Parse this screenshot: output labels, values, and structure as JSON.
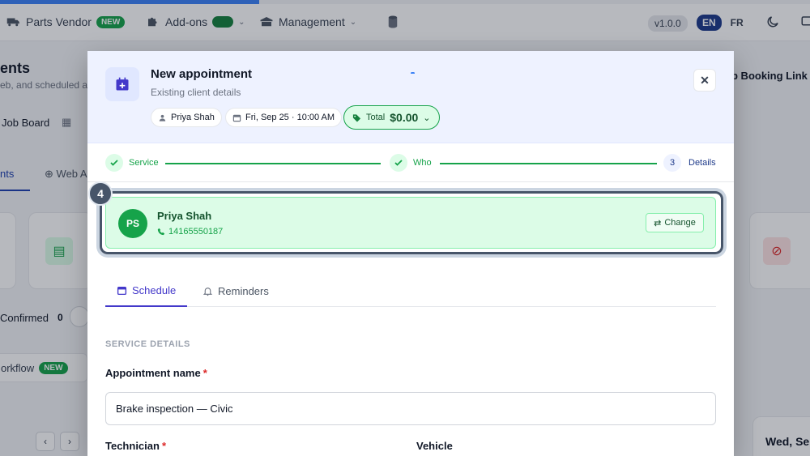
{
  "progress": {
    "fraction": 0.32
  },
  "topnav": {
    "parts_vendor": "Parts Vendor",
    "parts_vendor_badge": "NEW",
    "addons": "Add-ons",
    "management": "Management",
    "version": "v1.0.0",
    "lang_en": "EN",
    "lang_fr": "FR"
  },
  "background": {
    "page_title_fragment": "ents",
    "subtitle_fragment": "eb, and scheduled ap",
    "job_board": "Job Board",
    "booking_link": "p Booking Link",
    "tab_fragment_active": "nts",
    "tab_fragment_web": "Web A",
    "confirmed_label": "Confirmed",
    "confirmed_count": "0",
    "workflow_label": "orkflow",
    "workflow_badge": "NEW",
    "date_fragment": "Wed, Se"
  },
  "modal": {
    "title": "New appointment",
    "subtitle": "Existing client details",
    "chip_client": "Priya Shah",
    "chip_datetime": "Fri, Sep 25 · 10:00 AM",
    "chip_total_label": "Total",
    "chip_total_value": "$0.00",
    "close_symbol": "✕",
    "steps": [
      {
        "label": "Service",
        "state": "done"
      },
      {
        "label": "Who",
        "state": "done"
      },
      {
        "label": "Details",
        "number": "3",
        "state": "current"
      }
    ],
    "step_marker": "4",
    "client": {
      "initials": "PS",
      "name": "Priya Shah",
      "phone": "14165550187",
      "change_label": "Change"
    },
    "tabs": [
      {
        "label": "Schedule",
        "active": true
      },
      {
        "label": "Reminders",
        "active": false
      }
    ],
    "section_label": "SERVICE DETAILS",
    "appointment_name_label": "Appointment name",
    "appointment_name_value": "Brake inspection — Civic",
    "technician_label": "Technician",
    "vehicle_label": "Vehicle",
    "required_mark": "*"
  },
  "colors": {
    "accent": "#4338ca",
    "success": "#16a34a",
    "header_bg": "#eef2ff",
    "progress": "#3b82f6"
  }
}
